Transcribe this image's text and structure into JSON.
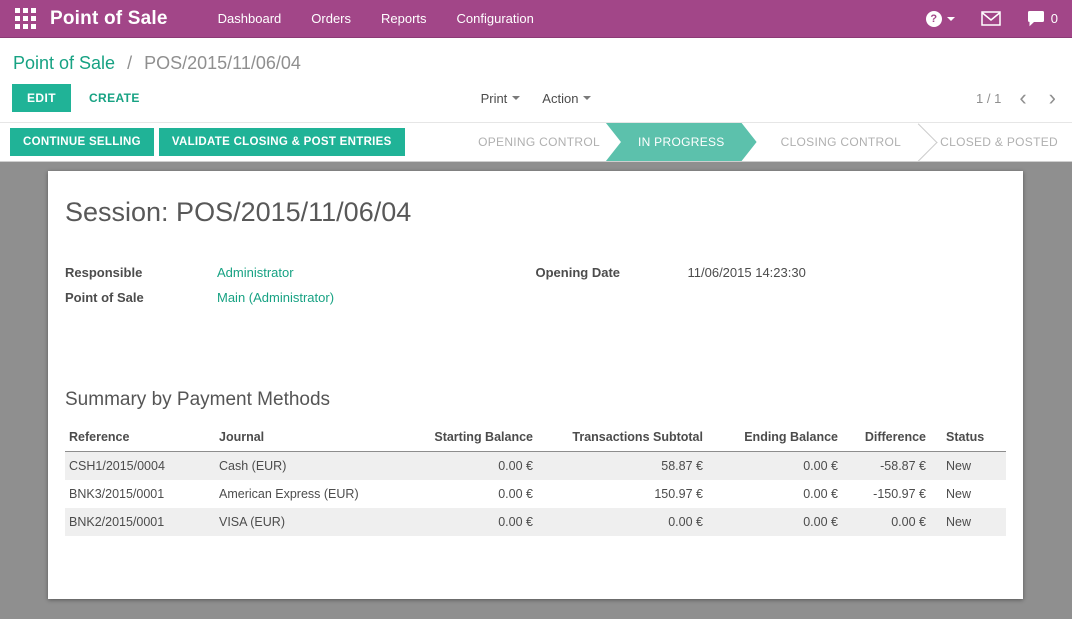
{
  "topbar": {
    "app_title": "Point of Sale",
    "menus": [
      "Dashboard",
      "Orders",
      "Reports",
      "Configuration"
    ],
    "help_glyph": "?",
    "chat_count": "0"
  },
  "breadcrumb": {
    "parent": "Point of Sale",
    "separator": "/",
    "current": "POS/2015/11/06/04"
  },
  "control_panel": {
    "edit_label": "EDIT",
    "create_label": "CREATE",
    "print_label": "Print",
    "action_label": "Action",
    "pager_value": "1 / 1",
    "pager_prev": "‹",
    "pager_next": "›"
  },
  "statusbar": {
    "buttons": [
      "CONTINUE SELLING",
      "VALIDATE CLOSING & POST ENTRIES"
    ],
    "steps": [
      {
        "label": "OPENING CONTROL",
        "active": false
      },
      {
        "label": "IN PROGRESS",
        "active": true
      },
      {
        "label": "CLOSING CONTROL",
        "active": false
      },
      {
        "label": "CLOSED & POSTED",
        "active": false
      }
    ]
  },
  "sheet": {
    "title": "Session: POS/2015/11/06/04",
    "fields": {
      "responsible_label": "Responsible",
      "responsible_value": "Administrator",
      "pos_label": "Point of Sale",
      "pos_value": "Main (Administrator)",
      "opening_date_label": "Opening Date",
      "opening_date_value": "11/06/2015 14:23:30"
    },
    "summary": {
      "title": "Summary by Payment Methods",
      "columns": [
        "Reference",
        "Journal",
        "Starting Balance",
        "Transactions Subtotal",
        "Ending Balance",
        "Difference",
        "Status"
      ],
      "rows": [
        [
          "CSH1/2015/0004",
          "Cash (EUR)",
          "0.00 €",
          "58.87 €",
          "0.00 €",
          "-58.87 €",
          "New"
        ],
        [
          "BNK3/2015/0001",
          "American Express (EUR)",
          "0.00 €",
          "150.97 €",
          "0.00 €",
          "-150.97 €",
          "New"
        ],
        [
          "BNK2/2015/0001",
          "VISA (EUR)",
          "0.00 €",
          "0.00 €",
          "0.00 €",
          "0.00 €",
          "New"
        ]
      ]
    }
  },
  "colors": {
    "topbar_bg": "#A24688",
    "button_teal": "#20B397",
    "step_active_bg": "#5CC1AC",
    "link_teal": "#17A283",
    "content_bg": "#8F8F8F"
  }
}
